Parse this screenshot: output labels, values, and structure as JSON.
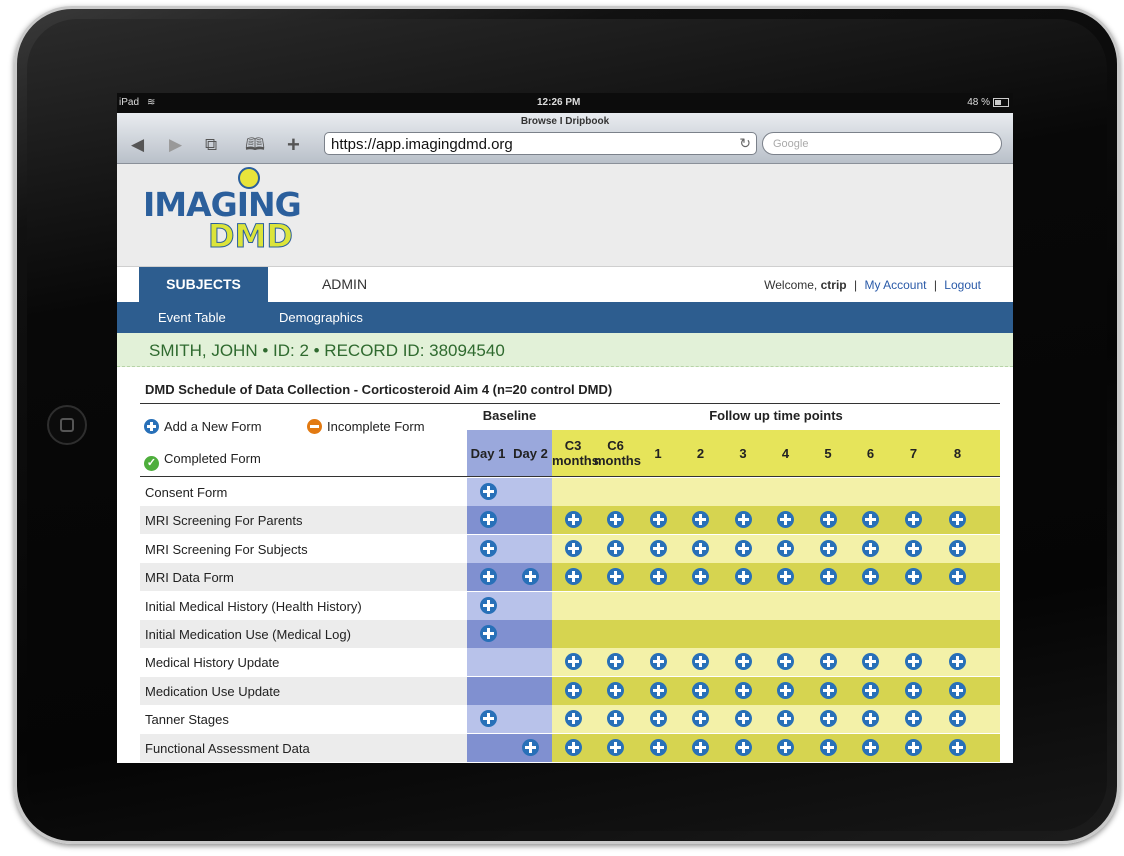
{
  "status_bar": {
    "carrier": "iPad",
    "time": "12:26 PM",
    "battery": "48 %"
  },
  "browser": {
    "title": "Browse I Dripbook",
    "url": "https://app.imagingdmd.org",
    "search_placeholder": "Google",
    "buttons": {
      "back": "◀",
      "forward": "▶",
      "tabs": "⧉",
      "bookmarks": "🕮",
      "add": "+",
      "reload": "↻"
    }
  },
  "logo": {
    "line1": "IMAGING",
    "line2": "DMD"
  },
  "nav": {
    "tabs": [
      {
        "label": "SUBJECTS"
      },
      {
        "label": "ADMIN"
      }
    ],
    "welcome_prefix": "Welcome,",
    "username": "ctrip",
    "sep": "|",
    "my_account": "My Account",
    "logout": "Logout"
  },
  "subnav": {
    "items": [
      {
        "label": "Event Table"
      },
      {
        "label": "Demographics"
      }
    ]
  },
  "record": {
    "text": "SMITH, JOHN • ID: 2 • RECORD ID: 38094540"
  },
  "schedule": {
    "title": "DMD Schedule of Data Collection - Corticosteroid Aim 4 (n=20 control DMD)",
    "legend": {
      "add": "Add a New Form",
      "incomplete": "Incomplete Form",
      "completed": "Completed Form"
    },
    "baseline_header": "Baseline",
    "follow_header": "Follow up time points",
    "columns": [
      {
        "l1": "Day 1",
        "l2": ""
      },
      {
        "l1": "Day 2",
        "l2": ""
      },
      {
        "l1": "C3",
        "l2": "months"
      },
      {
        "l1": "C6",
        "l2": "months"
      },
      {
        "l1": "1",
        "l2": ""
      },
      {
        "l1": "2",
        "l2": ""
      },
      {
        "l1": "3",
        "l2": ""
      },
      {
        "l1": "4",
        "l2": ""
      },
      {
        "l1": "5",
        "l2": ""
      },
      {
        "l1": "6",
        "l2": ""
      },
      {
        "l1": "7",
        "l2": ""
      },
      {
        "l1": "8",
        "l2": ""
      }
    ],
    "rows": [
      {
        "label": "Consent Form",
        "cells": [
          1,
          0,
          0,
          0,
          0,
          0,
          0,
          0,
          0,
          0,
          0,
          0
        ]
      },
      {
        "label": "MRI Screening For Parents",
        "cells": [
          1,
          0,
          1,
          1,
          1,
          1,
          1,
          1,
          1,
          1,
          1,
          1
        ]
      },
      {
        "label": "MRI Screening For Subjects",
        "cells": [
          1,
          0,
          1,
          1,
          1,
          1,
          1,
          1,
          1,
          1,
          1,
          1
        ]
      },
      {
        "label": "MRI Data Form",
        "cells": [
          1,
          1,
          1,
          1,
          1,
          1,
          1,
          1,
          1,
          1,
          1,
          1
        ]
      },
      {
        "label": "Initial Medical History (Health History)",
        "cells": [
          1,
          0,
          0,
          0,
          0,
          0,
          0,
          0,
          0,
          0,
          0,
          0
        ]
      },
      {
        "label": "Initial Medication Use (Medical Log)",
        "cells": [
          1,
          0,
          0,
          0,
          0,
          0,
          0,
          0,
          0,
          0,
          0,
          0
        ]
      },
      {
        "label": "Medical History Update",
        "cells": [
          0,
          0,
          1,
          1,
          1,
          1,
          1,
          1,
          1,
          1,
          1,
          1
        ]
      },
      {
        "label": "Medication Use Update",
        "cells": [
          0,
          0,
          1,
          1,
          1,
          1,
          1,
          1,
          1,
          1,
          1,
          1
        ]
      },
      {
        "label": "Tanner Stages",
        "cells": [
          1,
          0,
          1,
          1,
          1,
          1,
          1,
          1,
          1,
          1,
          1,
          1
        ]
      },
      {
        "label": "Functional Assessment Data",
        "cells": [
          0,
          1,
          1,
          1,
          1,
          1,
          1,
          1,
          1,
          1,
          1,
          1
        ]
      }
    ]
  },
  "colors": {
    "nav_blue": "#2d5d8f",
    "baseline_dark": "#8090d0",
    "baseline_light": "#b8c2ea",
    "follow_dark": "#d6d450",
    "follow_light": "#f3f1a8",
    "add_icon": "#2870b8",
    "incomplete_icon": "#e27a12",
    "completed_icon": "#4eae3c"
  }
}
